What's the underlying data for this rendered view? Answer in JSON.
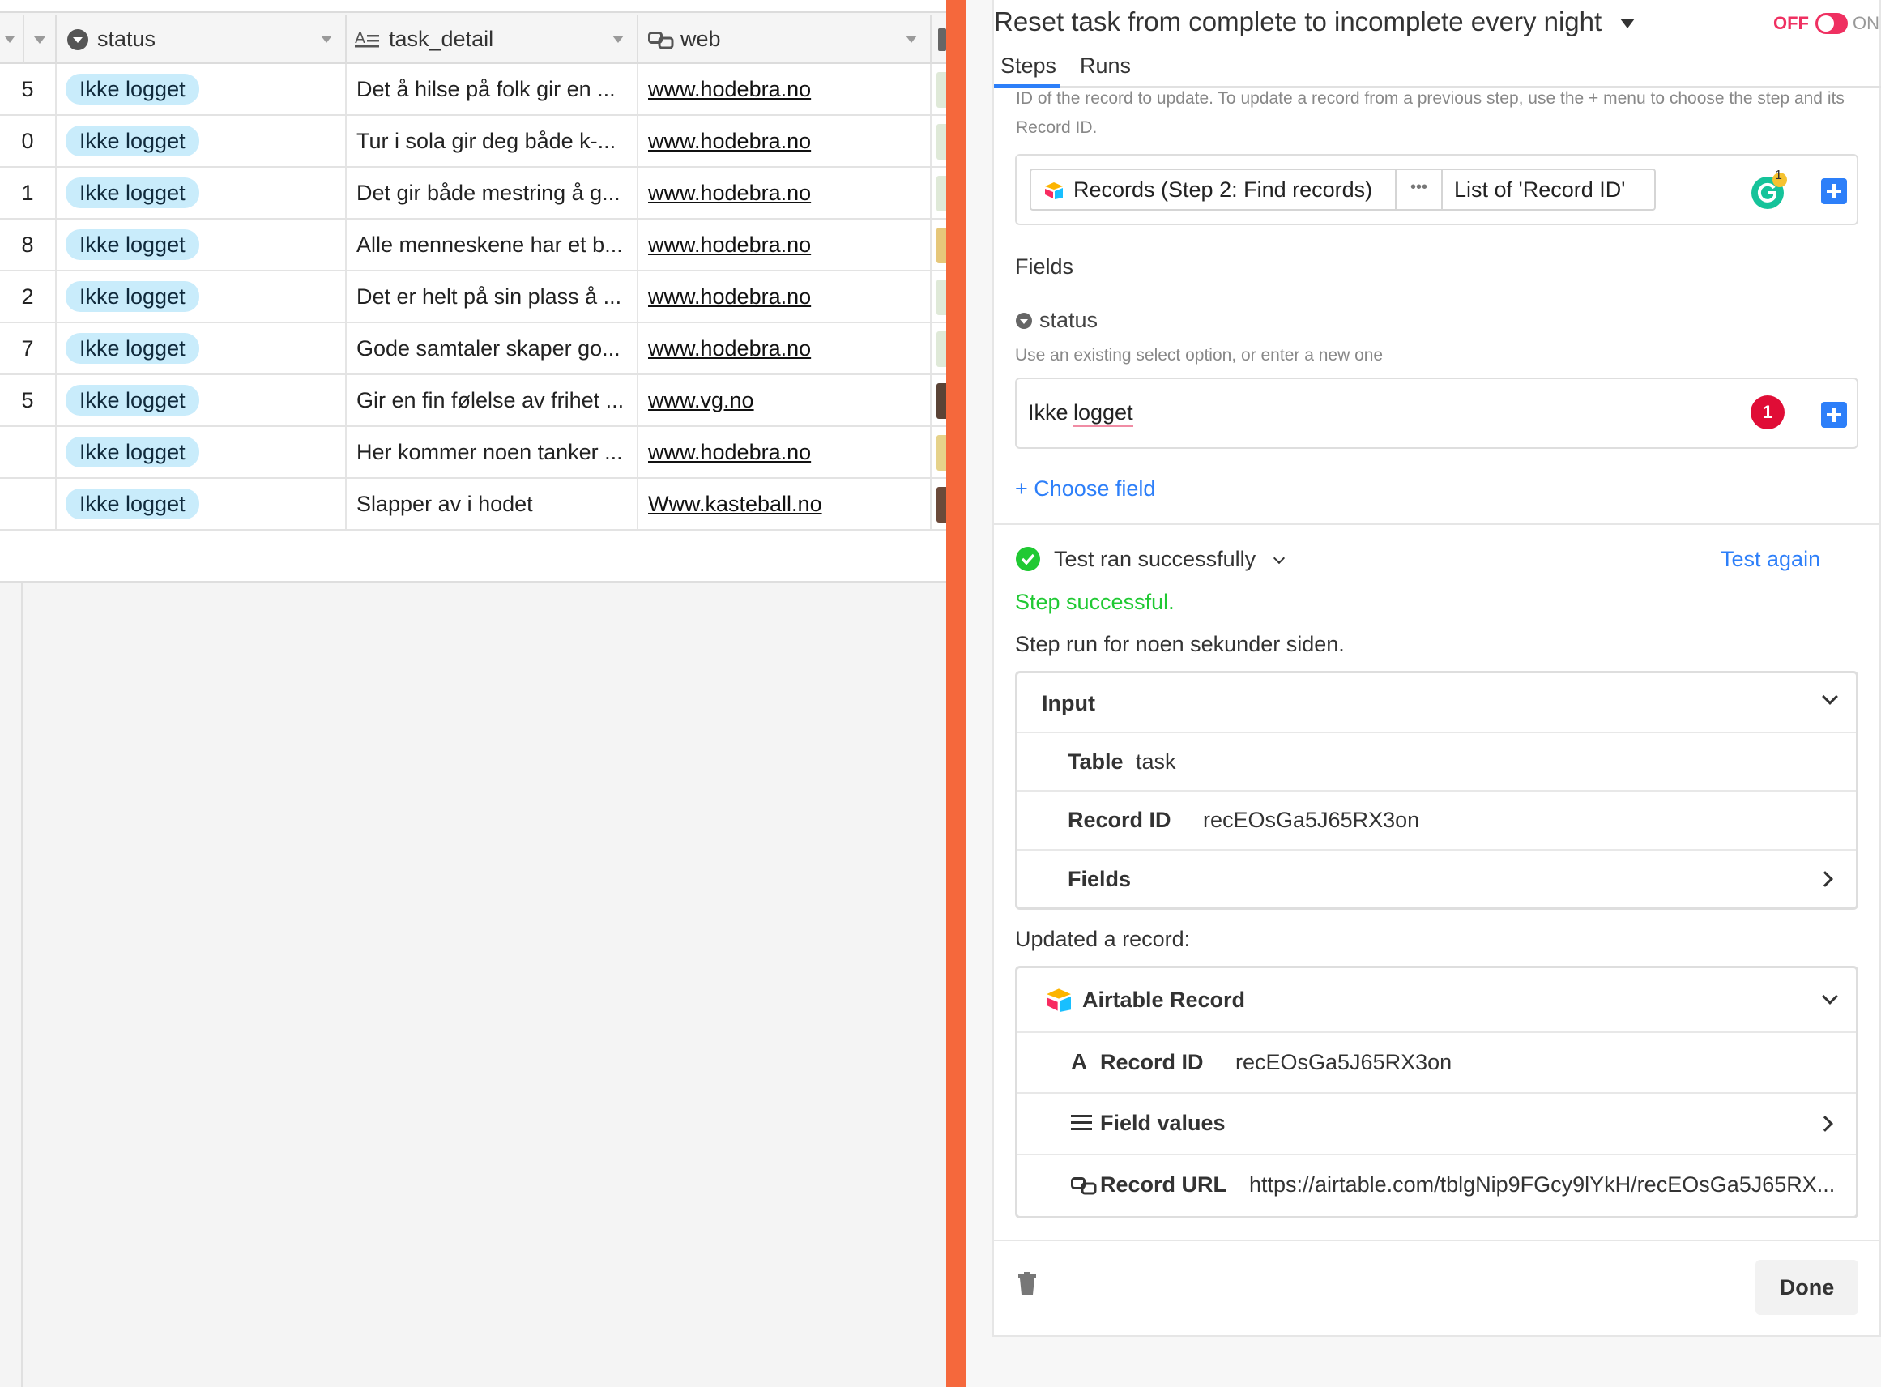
{
  "grid": {
    "columns": [
      {
        "key": "status",
        "label": "status"
      },
      {
        "key": "task_detail",
        "label": "task_detail"
      },
      {
        "key": "web",
        "label": "web"
      }
    ],
    "rows": [
      {
        "num": "5",
        "status": "Ikke logget",
        "detail": "Det å hilse på folk gir en ...",
        "web": "www.hodebra.no"
      },
      {
        "num": "0",
        "status": "Ikke logget",
        "detail": "Tur i sola gir deg både k-...",
        "web": "www.hodebra.no"
      },
      {
        "num": "1",
        "status": "Ikke logget",
        "detail": "Det gir både mestring å g...",
        "web": "www.hodebra.no"
      },
      {
        "num": "8",
        "status": "Ikke logget",
        "detail": "Alle menneskene har et b...",
        "web": "www.hodebra.no"
      },
      {
        "num": "2",
        "status": "Ikke logget",
        "detail": "Det er helt på sin plass å ...",
        "web": "www.hodebra.no"
      },
      {
        "num": "7",
        "status": "Ikke logget",
        "detail": "Gode samtaler skaper go...",
        "web": "www.hodebra.no"
      },
      {
        "num": "5",
        "status": "Ikke logget",
        "detail": "Gir en fin følelse av frihet ...",
        "web": "www.vg.no"
      },
      {
        "num": "",
        "status": "Ikke logget",
        "detail": "Her kommer noen tanker ...",
        "web": "www.hodebra.no"
      },
      {
        "num": "",
        "status": "Ikke logget",
        "detail": "Slapper av i hodet",
        "web": "Www.kasteball.no"
      }
    ]
  },
  "automation": {
    "title": "Reset task from complete to incomplete every night",
    "toggle_off": "OFF",
    "toggle_on": "ON",
    "tabs": [
      "Steps",
      "Runs"
    ],
    "record_id_help": "ID of the record to update. To update a record from a previous step, use the + menu to choose the step and its Record ID.",
    "token_label": "Records (Step 2: Find records)",
    "token_more": "•••",
    "token_list": "List of 'Record ID'",
    "grammarly_count": "1",
    "fields_heading": "Fields",
    "status_field_name": "status",
    "status_help": "Use an existing select option, or enter a new one",
    "status_value_a": "Ikke",
    "status_value_b": "logget",
    "status_badge": "1",
    "choose_field": "+ Choose field",
    "test_status": "Test ran successfully",
    "test_again": "Test again",
    "step_success": "Step successful.",
    "step_run": "Step run for noen sekunder siden.",
    "input": {
      "title": "Input",
      "table_label": "Table",
      "table_value": "task",
      "record_label": "Record ID",
      "record_value": "recEOsGa5J65RX3on",
      "fields_label": "Fields"
    },
    "updated_label": "Updated a record:",
    "output": {
      "title": "Airtable Record",
      "record_label": "Record ID",
      "record_value": "recEOsGa5J65RX3on",
      "field_values_label": "Field values",
      "url_label": "Record URL",
      "url_value": "https://airtable.com/tblgNip9FGcy9lYkH/recEOsGa5J65RX..."
    },
    "done_label": "Done"
  },
  "colors": {
    "divider": "#f5683c",
    "pill": "#c9ecfb",
    "primary_blue": "#2d7ff9",
    "success_green": "#20c933",
    "toggle_red": "#ef3061"
  }
}
